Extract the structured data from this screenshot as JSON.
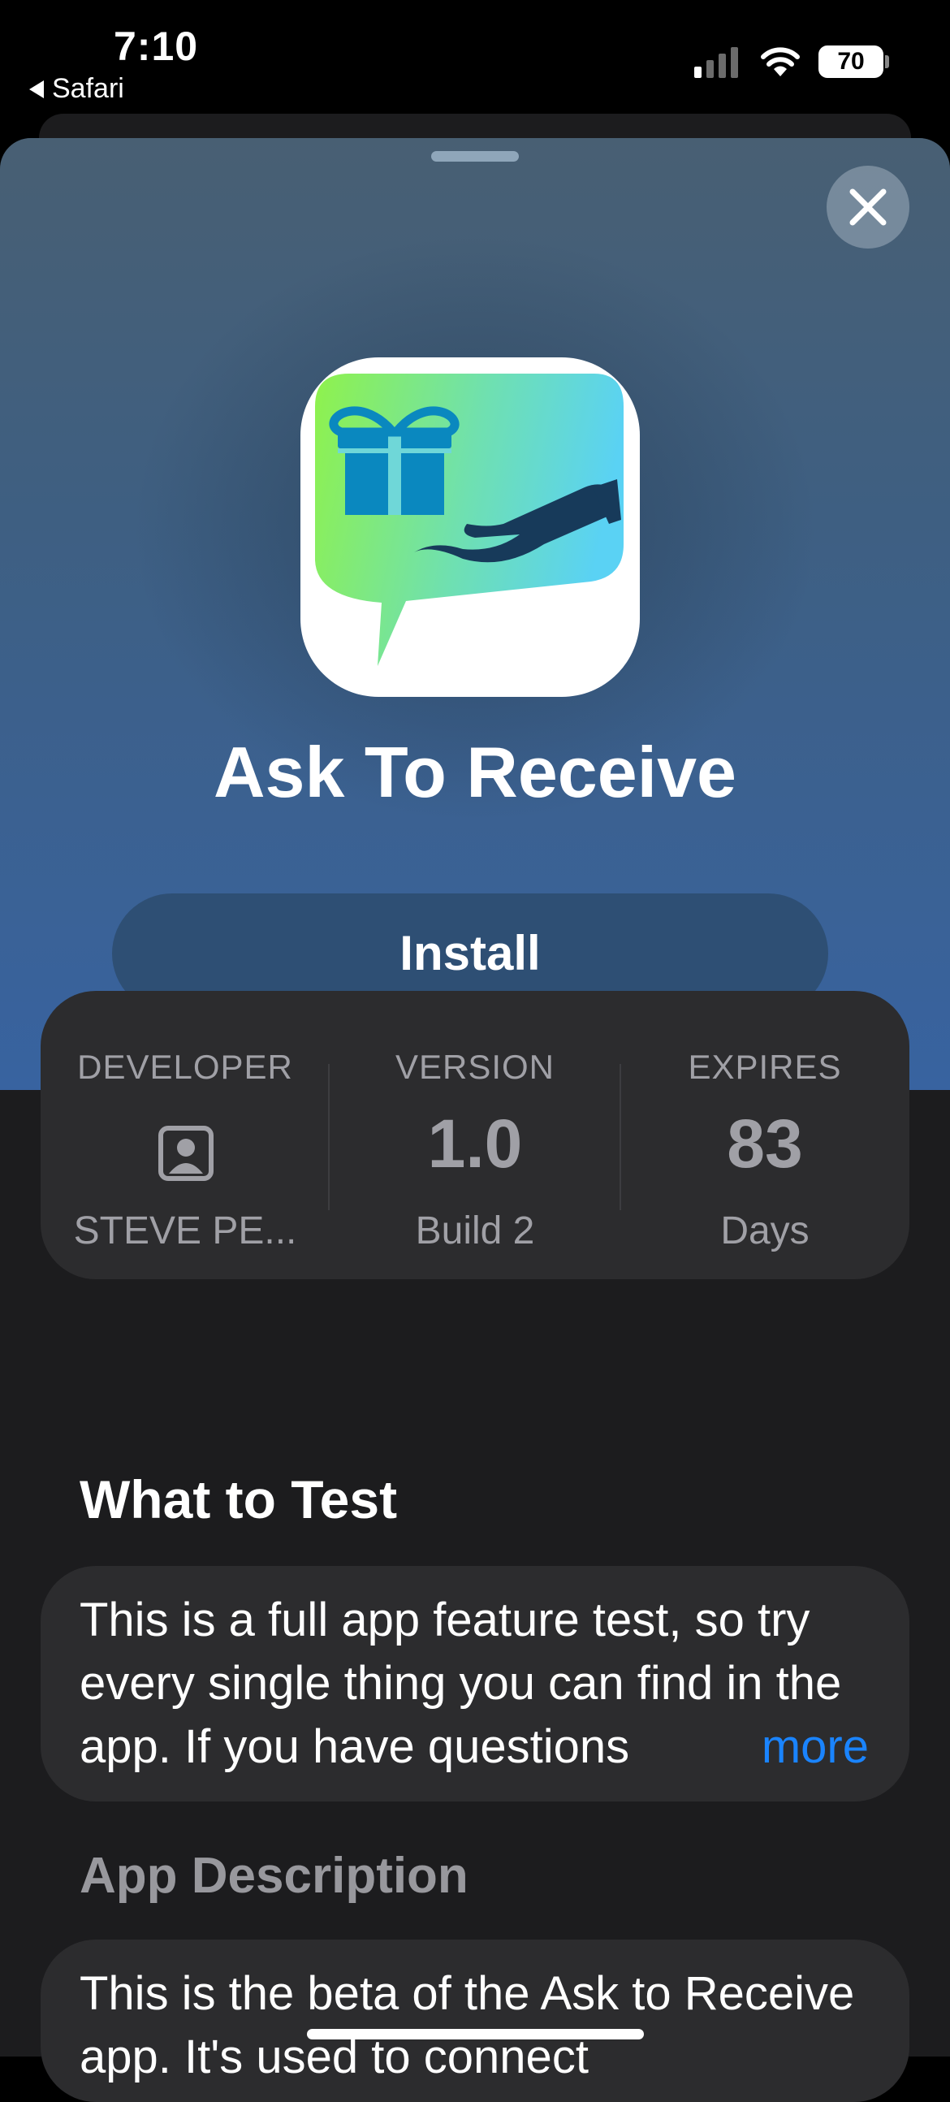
{
  "status_bar": {
    "time": "7:10",
    "back_app": "Safari",
    "battery": "70"
  },
  "app": {
    "name": "Ask To Receive",
    "install_label": "Install"
  },
  "info": {
    "developer": {
      "label": "DEVELOPER",
      "value": "STEVE PE..."
    },
    "version": {
      "label": "VERSION",
      "value": "1.0",
      "sub": "Build 2"
    },
    "expires": {
      "label": "EXPIRES",
      "value": "83",
      "sub": "Days"
    }
  },
  "what_to_test": {
    "title": "What to Test",
    "text": "This is a full app feature test, so try every single thing you can find in the app.  If you have questions",
    "more_label": "more"
  },
  "description": {
    "title": "App Description",
    "text": "This is the beta of the Ask to Receive app.  It's used to connect"
  },
  "icons": [
    "close-icon",
    "person-icon",
    "gift-icon",
    "hand-icon",
    "wifi-icon",
    "signal-icon",
    "battery-icon"
  ],
  "colors": {
    "accent": "#1a84ff",
    "install_bg": "#2e4f74",
    "card_bg": "#2c2c2e"
  }
}
